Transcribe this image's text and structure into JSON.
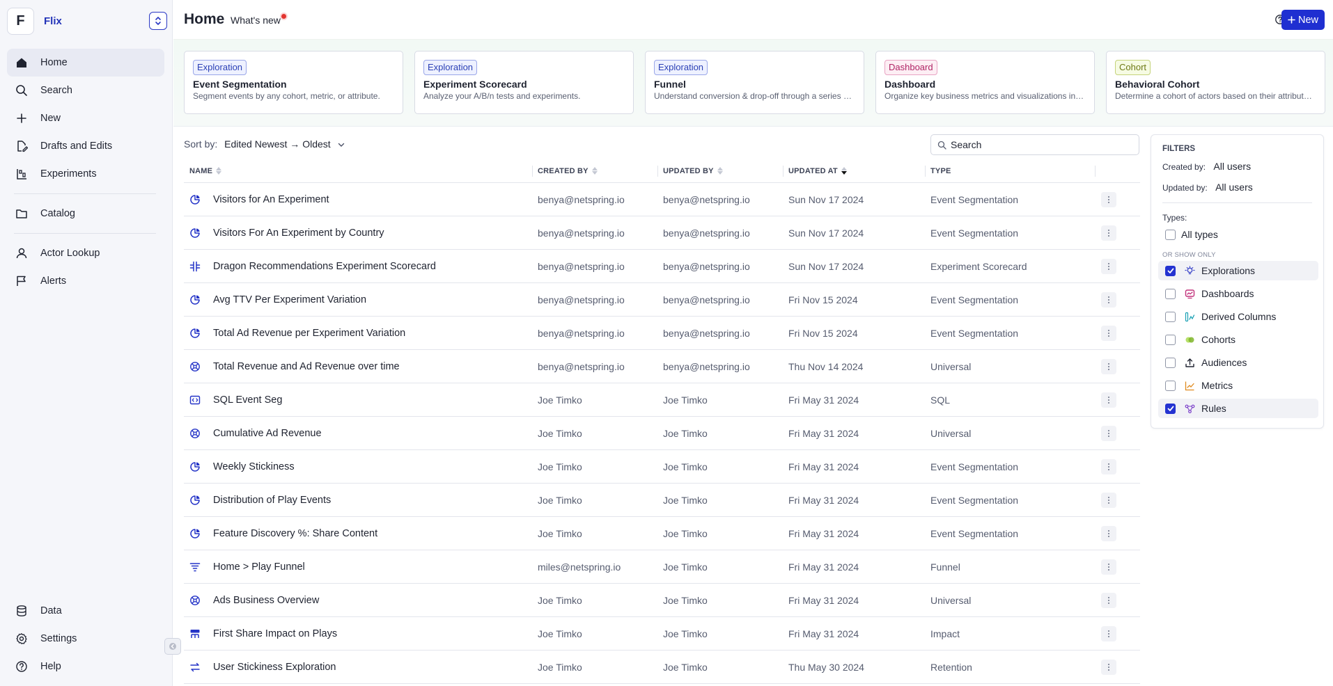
{
  "org": {
    "initial": "F",
    "name": "Flix"
  },
  "nav": {
    "main": [
      {
        "label": "Home",
        "icon": "home-icon",
        "active": true
      },
      {
        "label": "Search",
        "icon": "search-icon"
      },
      {
        "label": "New",
        "icon": "plus-icon"
      },
      {
        "label": "Drafts and Edits",
        "icon": "drafts-icon"
      },
      {
        "label": "Experiments",
        "icon": "experiments-icon"
      }
    ],
    "catalog": {
      "label": "Catalog",
      "icon": "folder-icon"
    },
    "secondary": [
      {
        "label": "Actor Lookup",
        "icon": "user-icon"
      },
      {
        "label": "Alerts",
        "icon": "flag-icon"
      }
    ],
    "bottom": [
      {
        "label": "Data",
        "icon": "database-icon"
      },
      {
        "label": "Settings",
        "icon": "gear-icon"
      },
      {
        "label": "Help",
        "icon": "help-icon"
      }
    ]
  },
  "header": {
    "title": "Home",
    "whats_new": "What's new",
    "new_button": "New"
  },
  "cards": [
    {
      "tag": "Exploration",
      "tag_kind": "exp",
      "title": "Event Segmentation",
      "desc": "Segment events by any cohort, metric, or attribute."
    },
    {
      "tag": "Exploration",
      "tag_kind": "exp",
      "title": "Experiment Scorecard",
      "desc": "Analyze your A/B/n tests and experiments."
    },
    {
      "tag": "Exploration",
      "tag_kind": "exp",
      "title": "Funnel",
      "desc": "Understand conversion & drop-off through a series of ..."
    },
    {
      "tag": "Dashboard",
      "tag_kind": "dash",
      "title": "Dashboard",
      "desc": "Organize key business metrics and visualizations into i..."
    },
    {
      "tag": "Cohort",
      "tag_kind": "coh",
      "title": "Behavioral Cohort",
      "desc": "Determine a cohort of actors based on their attributes ..."
    }
  ],
  "sort": {
    "label": "Sort by:",
    "value": "Edited Newest → Oldest"
  },
  "search": {
    "placeholder": "Search"
  },
  "table": {
    "columns": [
      "NAME",
      "CREATED BY",
      "UPDATED BY",
      "UPDATED AT",
      "TYPE"
    ],
    "rows": [
      {
        "name": "Visitors for An Experiment",
        "icon": "pie-icon",
        "created_by": "benya@netspring.io",
        "updated_by": "benya@netspring.io",
        "updated_at": "Sun Nov 17 2024",
        "type": "Event Segmentation"
      },
      {
        "name": "Visitors For An Experiment by Country",
        "icon": "pie-icon",
        "created_by": "benya@netspring.io",
        "updated_by": "benya@netspring.io",
        "updated_at": "Sun Nov 17 2024",
        "type": "Event Segmentation"
      },
      {
        "name": "Dragon Recommendations Experiment Scorecard",
        "icon": "scorecard-icon",
        "created_by": "benya@netspring.io",
        "updated_by": "benya@netspring.io",
        "updated_at": "Sun Nov 17 2024",
        "type": "Experiment Scorecard"
      },
      {
        "name": "Avg TTV Per Experiment Variation",
        "icon": "pie-icon",
        "created_by": "benya@netspring.io",
        "updated_by": "benya@netspring.io",
        "updated_at": "Fri Nov 15 2024",
        "type": "Event Segmentation"
      },
      {
        "name": "Total Ad Revenue per Experiment Variation",
        "icon": "pie-icon",
        "created_by": "benya@netspring.io",
        "updated_by": "benya@netspring.io",
        "updated_at": "Fri Nov 15 2024",
        "type": "Event Segmentation"
      },
      {
        "name": "Total Revenue and Ad Revenue over time",
        "icon": "universal-icon",
        "created_by": "benya@netspring.io",
        "updated_by": "benya@netspring.io",
        "updated_at": "Thu Nov 14 2024",
        "type": "Universal"
      },
      {
        "name": "SQL Event Seg",
        "icon": "sql-icon",
        "created_by": "Joe Timko",
        "updated_by": "Joe Timko",
        "updated_at": "Fri May 31 2024",
        "type": "SQL"
      },
      {
        "name": "Cumulative Ad Revenue",
        "icon": "universal-icon",
        "created_by": "Joe Timko",
        "updated_by": "Joe Timko",
        "updated_at": "Fri May 31 2024",
        "type": "Universal"
      },
      {
        "name": "Weekly Stickiness",
        "icon": "pie-icon",
        "created_by": "Joe Timko",
        "updated_by": "Joe Timko",
        "updated_at": "Fri May 31 2024",
        "type": "Event Segmentation"
      },
      {
        "name": "Distribution of Play Events",
        "icon": "pie-icon",
        "created_by": "Joe Timko",
        "updated_by": "Joe Timko",
        "updated_at": "Fri May 31 2024",
        "type": "Event Segmentation"
      },
      {
        "name": "Feature Discovery %: Share Content",
        "icon": "pie-icon",
        "created_by": "Joe Timko",
        "updated_by": "Joe Timko",
        "updated_at": "Fri May 31 2024",
        "type": "Event Segmentation"
      },
      {
        "name": "Home > Play Funnel",
        "icon": "funnel-icon",
        "created_by": "miles@netspring.io",
        "updated_by": "Joe Timko",
        "updated_at": "Fri May 31 2024",
        "type": "Funnel"
      },
      {
        "name": "Ads Business Overview",
        "icon": "universal-icon",
        "created_by": "Joe Timko",
        "updated_by": "Joe Timko",
        "updated_at": "Fri May 31 2024",
        "type": "Universal"
      },
      {
        "name": "First Share Impact on Plays",
        "icon": "impact-icon",
        "created_by": "Joe Timko",
        "updated_by": "Joe Timko",
        "updated_at": "Fri May 31 2024",
        "type": "Impact"
      },
      {
        "name": "User Stickiness Exploration",
        "icon": "retention-icon",
        "created_by": "Joe Timko",
        "updated_by": "Joe Timko",
        "updated_at": "Thu May 30 2024",
        "type": "Retention"
      }
    ]
  },
  "filters": {
    "title": "FILTERS",
    "created_by_label": "Created by:",
    "created_by_value": "All users",
    "updated_by_label": "Updated by:",
    "updated_by_value": "All users",
    "types_label": "Types:",
    "all_types": "All types",
    "or_show_only": "OR SHOW ONLY",
    "options": [
      {
        "label": "Explorations",
        "icon": "bulb-icon",
        "checked": true,
        "color": "#3b45c9"
      },
      {
        "label": "Dashboards",
        "icon": "dashboard-icon",
        "checked": false,
        "color": "#c2307a"
      },
      {
        "label": "Derived Columns",
        "icon": "derived-column-icon",
        "checked": false,
        "color": "#1aa0b4"
      },
      {
        "label": "Cohorts",
        "icon": "cohort-icon",
        "checked": false,
        "color": "#7fb52a"
      },
      {
        "label": "Audiences",
        "icon": "upload-icon",
        "checked": false,
        "color": "#1f2330"
      },
      {
        "label": "Metrics",
        "icon": "metrics-icon",
        "checked": false,
        "color": "#e08a1e"
      },
      {
        "label": "Rules",
        "icon": "rules-icon",
        "checked": true,
        "color": "#7b3fc9"
      }
    ]
  },
  "colors": {
    "brand": "#1f2fd1",
    "accent_text": "#2233b8",
    "sidebar_bg": "#f5f6fa"
  }
}
